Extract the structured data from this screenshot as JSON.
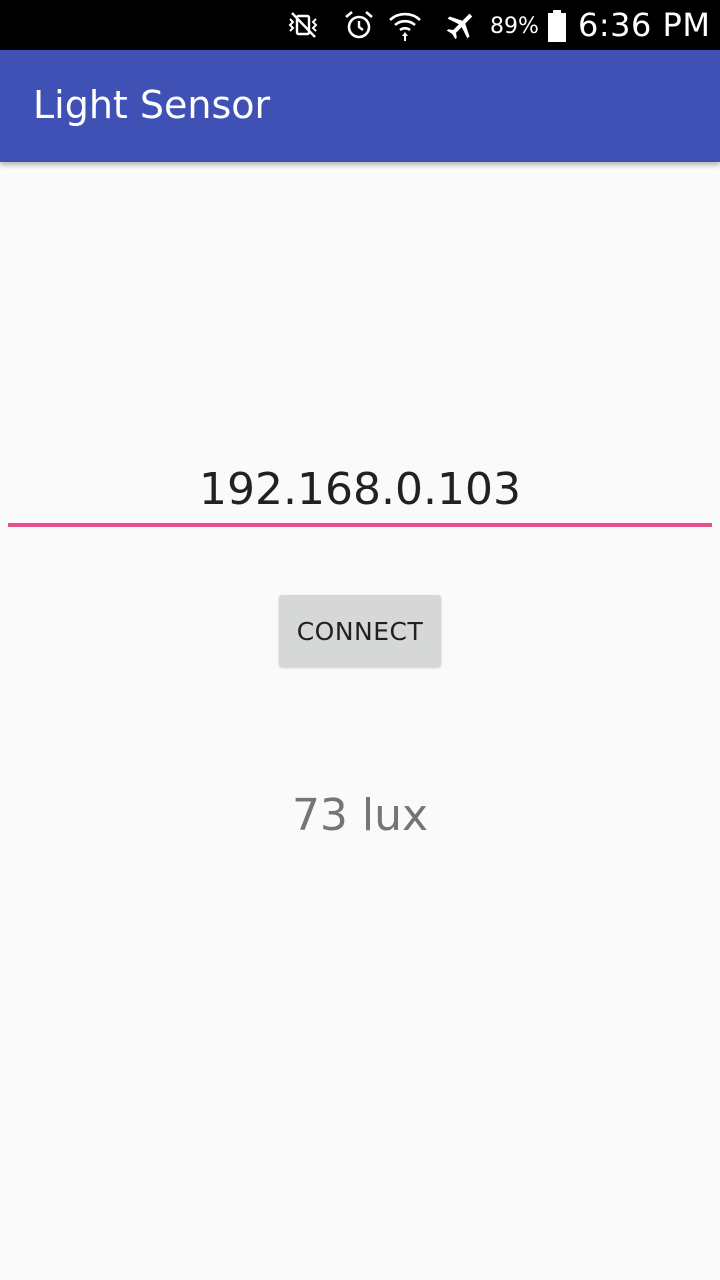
{
  "status_bar": {
    "icons": [
      "vibrate-mute-icon",
      "alarm-icon",
      "wifi-icon",
      "airplane-mode-icon",
      "battery-icon"
    ],
    "battery_percent": "89%",
    "time": "6:36 PM"
  },
  "app_bar": {
    "title": "Light Sensor",
    "color": "#3f51b5"
  },
  "main": {
    "ip_input_value": "192.168.0.103",
    "connect_label": "CONNECT",
    "reading": "73 lux",
    "accent_color": "#e8528c"
  }
}
